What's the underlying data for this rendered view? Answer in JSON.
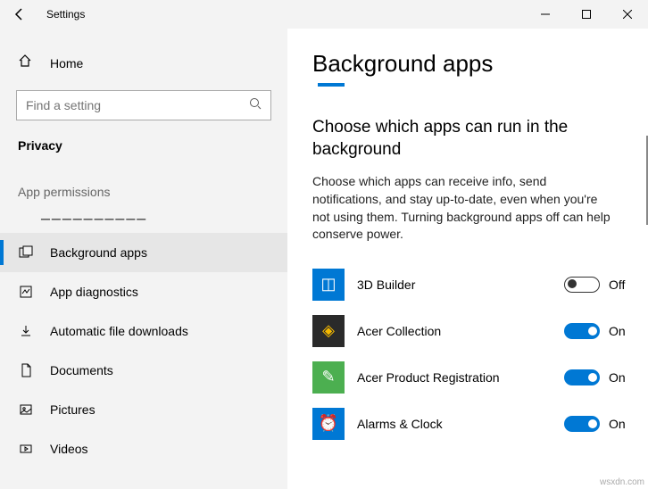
{
  "window": {
    "title": "Settings"
  },
  "sidebar": {
    "home": "Home",
    "search_placeholder": "Find a setting",
    "category": "Privacy",
    "section": "App permissions",
    "truncated_top": "Other devices",
    "items": [
      {
        "label": "Background apps",
        "selected": true
      },
      {
        "label": "App diagnostics",
        "selected": false
      },
      {
        "label": "Automatic file downloads",
        "selected": false
      },
      {
        "label": "Documents",
        "selected": false
      },
      {
        "label": "Pictures",
        "selected": false
      },
      {
        "label": "Videos",
        "selected": false
      }
    ]
  },
  "page": {
    "title": "Background apps",
    "subheading": "Choose which apps can run in the background",
    "description": "Choose which apps can receive info, send notifications, and stay up-to-date, even when you're not using them. Turning background apps off can help conserve power.",
    "apps": [
      {
        "name": "3D Builder",
        "state": "Off",
        "on": false,
        "icon_bg": "#0078d4",
        "icon_glyph": "◫"
      },
      {
        "name": "Acer Collection",
        "state": "On",
        "on": true,
        "icon_bg": "#2a2a2a",
        "icon_glyph": "◈",
        "icon_color": "#f5b900"
      },
      {
        "name": "Acer Product Registration",
        "state": "On",
        "on": true,
        "icon_bg": "#4caf50",
        "icon_glyph": "✎",
        "icon_color": "#fff"
      },
      {
        "name": "Alarms & Clock",
        "state": "On",
        "on": true,
        "icon_bg": "#0078d4",
        "icon_glyph": "⏰",
        "icon_color": "#fff"
      }
    ]
  },
  "watermark": "wsxdn.com"
}
